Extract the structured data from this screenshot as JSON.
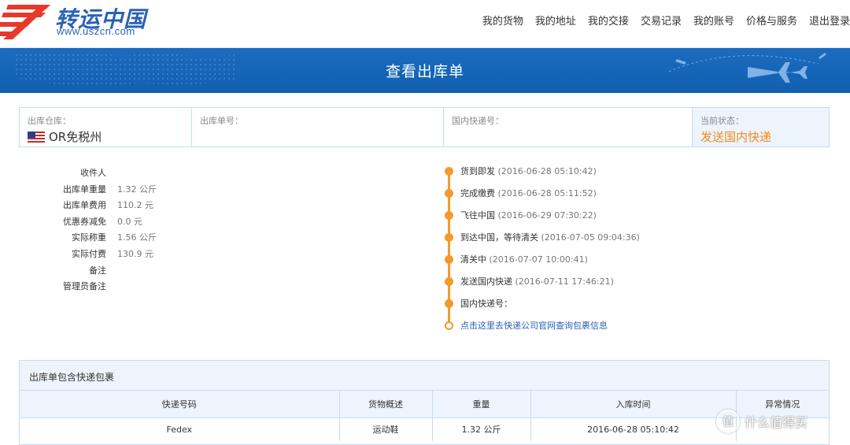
{
  "brand": {
    "name_cn": "转运中国",
    "url": "www.uszcn.com"
  },
  "nav": [
    "我的货物",
    "我的地址",
    "我的交接",
    "交易记录",
    "我的账号",
    "价格与服务",
    "退出登录"
  ],
  "banner": {
    "title": "查看出库单"
  },
  "status_row": {
    "warehouse_label": "出库仓库：",
    "warehouse_value": "OR免税州",
    "order_no_label": "出库单号：",
    "order_no_value": "",
    "domestic_no_label": "国内快递号：",
    "domestic_no_value": "",
    "state_label": "当前状态：",
    "state_value": "发送国内快递"
  },
  "info": [
    {
      "key": "收件人",
      "value": ""
    },
    {
      "key": "",
      "value": ""
    },
    {
      "key": "出库单重量",
      "value": "1.32 公斤"
    },
    {
      "key": "出库单费用",
      "value": "110.2 元"
    },
    {
      "key": "优惠券减免",
      "value": "0.0 元"
    },
    {
      "key": "实际称重",
      "value": "1.56 公斤"
    },
    {
      "key": "实际付费",
      "value": "130.9 元"
    },
    {
      "key": "备注",
      "value": ""
    },
    {
      "key": "管理员备注",
      "value": ""
    }
  ],
  "timeline": [
    {
      "label": "货到即发",
      "time": "(2016-06-28 05:10:42)"
    },
    {
      "label": "完成缴费",
      "time": "(2016-06-28 05:11:52)"
    },
    {
      "label": "飞往中国",
      "time": "(2016-06-29 07:30:22)"
    },
    {
      "label": "到达中国，等待清关",
      "time": "(2016-07-05 09:04:36)"
    },
    {
      "label": "清关中",
      "time": "(2016-07-07 10:00:41)"
    },
    {
      "label": "发送国内快递",
      "time": "(2016-07-11 17:46:21)"
    },
    {
      "label": "国内快递号：",
      "time": ""
    }
  ],
  "timeline_link": "点击这里去快递公司官网查询包裹信息",
  "packages": {
    "title": "出库单包含快递包裹",
    "headers": [
      "快递号码",
      "货物概述",
      "重量",
      "入库时间",
      "异常情况"
    ],
    "rows": [
      [
        "Fedex",
        "运动鞋",
        "1.32 公斤",
        "2016-06-28 05:10:42",
        ""
      ]
    ]
  },
  "watermark": {
    "icon": "值",
    "text": "什么值得买"
  }
}
